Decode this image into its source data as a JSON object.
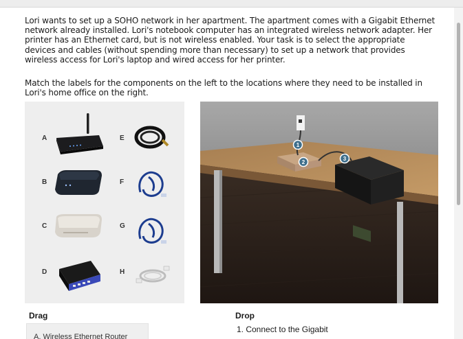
{
  "instructions": {
    "paragraph1": "Lori wants to set up a SOHO network in her apartment. The apartment comes with a Gigabit Ethernet network already installed. Lori's notebook computer has an integrated wireless network adapter. Her printer has an Ethernet card, but is not wireless enabled. Your task is to select the appropriate devices and cables (without spending more than necessary) to set up a network that provides wireless access for Lori's laptop and wired access for her printer.",
    "paragraph2": "Match the labels for the components on the left to the locations where they need to be installed in Lori's home office on the right."
  },
  "components": [
    {
      "letter": "A",
      "icon": "wireless-router-icon"
    },
    {
      "letter": "B",
      "icon": "router-icon"
    },
    {
      "letter": "C",
      "icon": "modem-icon"
    },
    {
      "letter": "D",
      "icon": "switch-icon"
    },
    {
      "letter": "E",
      "icon": "coax-cable-icon"
    },
    {
      "letter": "F",
      "icon": "ethernet-cable-icon"
    },
    {
      "letter": "G",
      "icon": "crossover-cable-icon"
    },
    {
      "letter": "H",
      "icon": "phone-cable-icon"
    }
  ],
  "scene": {
    "markers": [
      "1",
      "2",
      "3"
    ],
    "marker_color": "#3f6f8c"
  },
  "drag": {
    "heading": "Drag",
    "first_item": "A. Wireless Ethernet Router"
  },
  "drop": {
    "heading": "Drop",
    "first_step": "1. Connect to the Gigabit"
  }
}
